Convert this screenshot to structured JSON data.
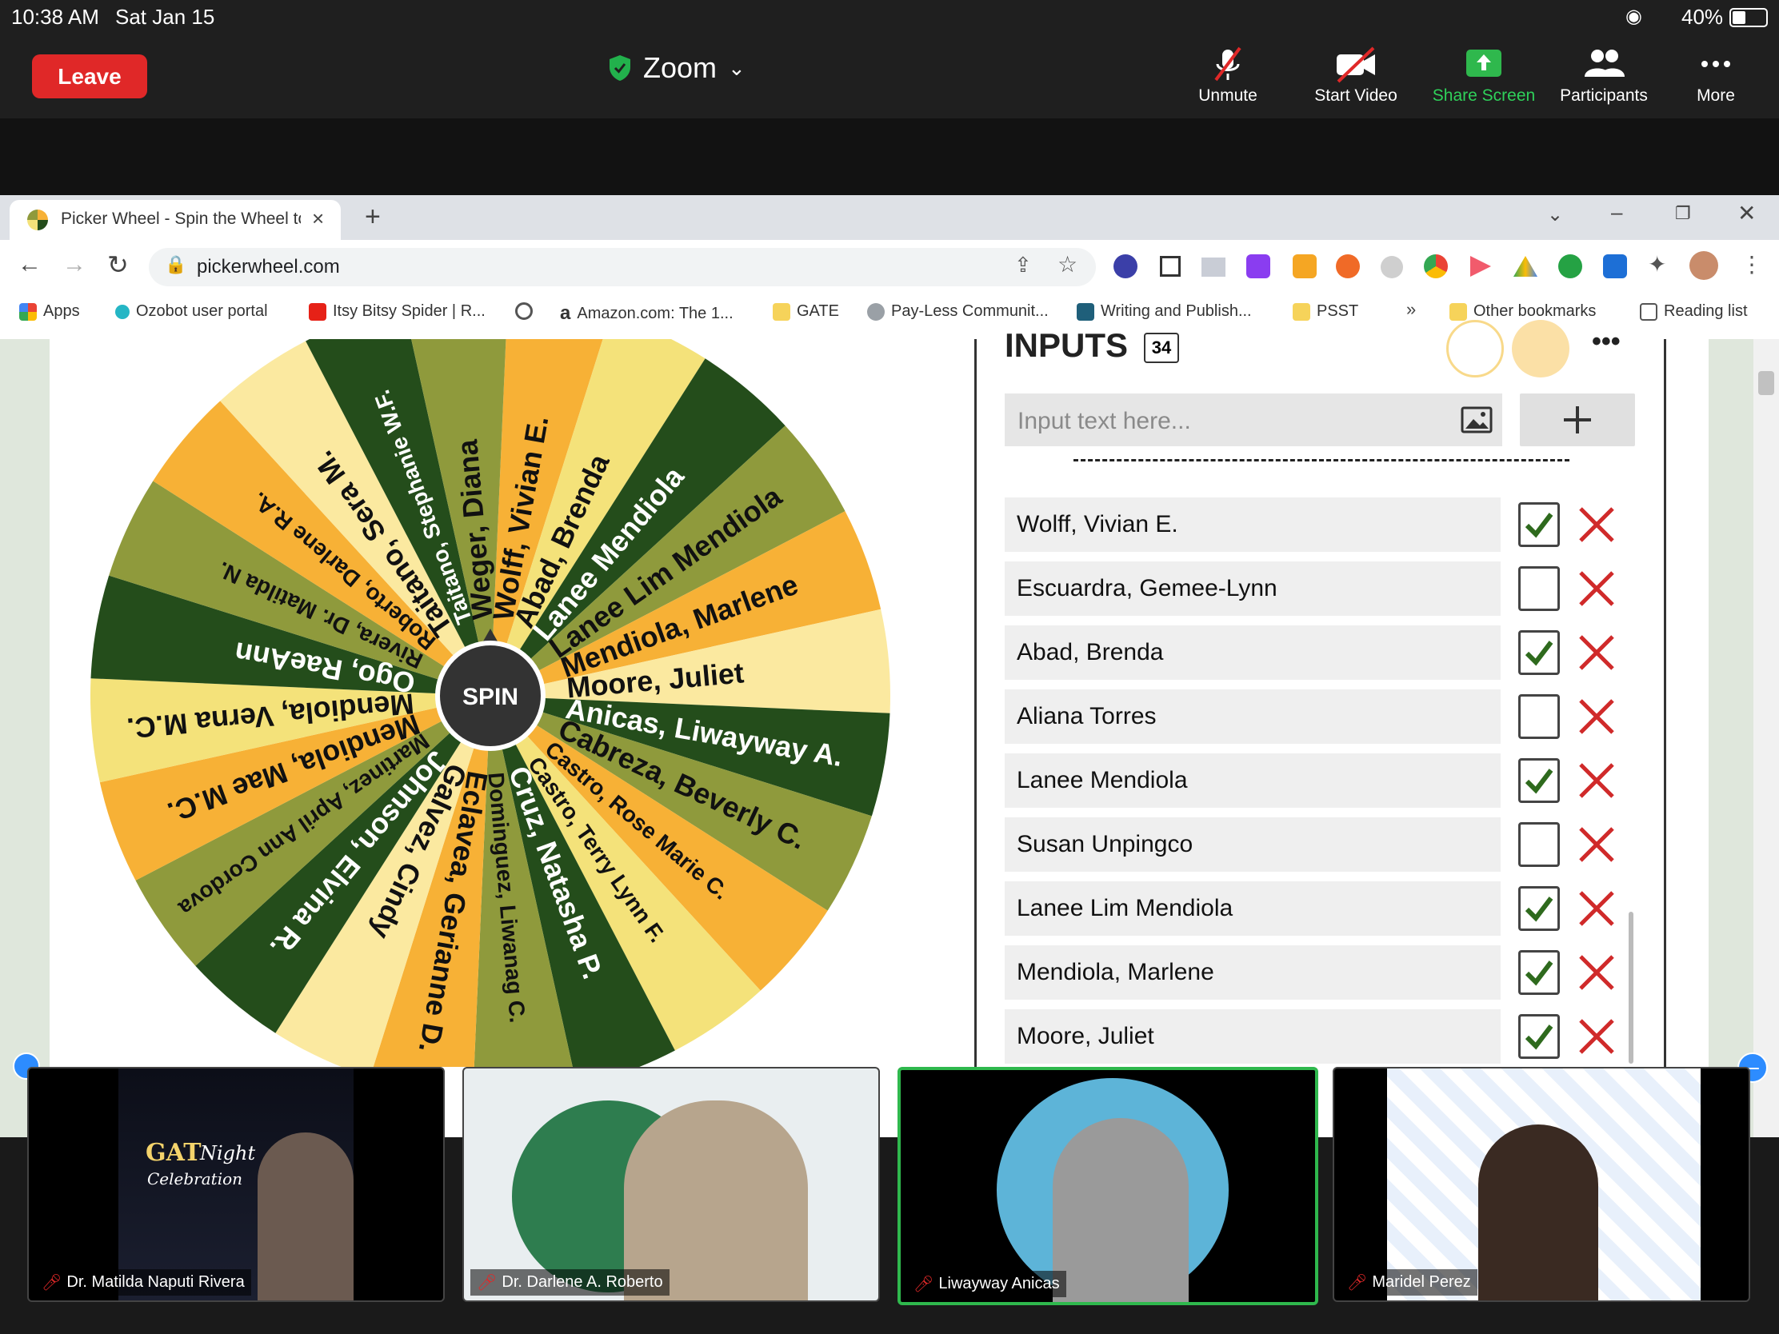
{
  "status_bar": {
    "time": "10:38 AM",
    "date": "Sat Jan 15",
    "battery": "40%"
  },
  "zoom": {
    "leave_label": "Leave",
    "meeting_title": "Zoom",
    "buttons": [
      "Unmute",
      "Start Video",
      "Share Screen",
      "Participants",
      "More"
    ]
  },
  "browser": {
    "tab_title": "Picker Wheel - Spin the Wheel to",
    "url": "pickerwheel.com",
    "bookmarks": [
      "Apps",
      "Ozobot user portal",
      "Itsy Bitsy Spider | R...",
      "Amazon.com: The 1...",
      "GATE",
      "Pay-Less Communit...",
      "Writing and Publish...",
      "PSST",
      "Other bookmarks",
      "Reading list"
    ]
  },
  "wheel": {
    "spin_label": "SPIN",
    "segments": [
      "Wolff, Vivian E.",
      "Abad, Brenda",
      "Lanee Mendiola",
      "Lanee Lim Mendiola",
      "Mendiola, Marlene",
      "Moore, Juliet",
      "Anicas, Liwayway A.",
      "Cabreza, Beverly C.",
      "Castro, Rose Marie C.",
      "Castro, Terry Lynn F.",
      "Cruz, Natasha P.",
      "Dominguez, Liwanag C.",
      "Eclavea, Gerianne D.",
      "Galvez, Cindy",
      "Johnson, Elvina R.",
      "Martinez, April Ann Cordova",
      "Mendiola, Mae M.C.",
      "Mendiola, Verna M.C.",
      "Ogo, RaeAnn",
      "Rivera, Dr. Matilda N.",
      "Roberto, Darlene R.A.",
      "Taitano, Sera M.",
      "Taitano, Stephanie W.F.",
      "Weger, Diana"
    ],
    "colors": [
      "#f7b136",
      "#f4e27a",
      "#244d1b",
      "#8f9a3c",
      "#f7b136",
      "#fbe9a0",
      "#244d1b",
      "#8f9a3c"
    ]
  },
  "inputs": {
    "title": "INPUTS",
    "count": "34",
    "placeholder": "Input text here...",
    "entries": [
      {
        "name": "Wolff, Vivian E.",
        "checked": true
      },
      {
        "name": "Escuardra, Gemee-Lynn",
        "checked": false
      },
      {
        "name": "Abad, Brenda",
        "checked": true
      },
      {
        "name": "Aliana Torres",
        "checked": false
      },
      {
        "name": "Lanee Mendiola",
        "checked": true
      },
      {
        "name": "Susan Unpingco",
        "checked": false
      },
      {
        "name": "Lanee Lim Mendiola",
        "checked": true
      },
      {
        "name": "Mendiola, Marlene",
        "checked": true
      },
      {
        "name": "Moore, Juliet",
        "checked": true
      }
    ]
  },
  "participants": [
    {
      "name": "Dr. Matilda Naputi Rivera",
      "active": false
    },
    {
      "name": "Dr. Darlene A. Roberto",
      "active": false
    },
    {
      "name": "Liwayway Anicas",
      "active": true
    },
    {
      "name": "Maridel Perez",
      "active": false
    }
  ],
  "tile_texts": {
    "gat_line1": "GAT",
    "gat_line2": "Night",
    "gat_line3": "Celebration"
  }
}
